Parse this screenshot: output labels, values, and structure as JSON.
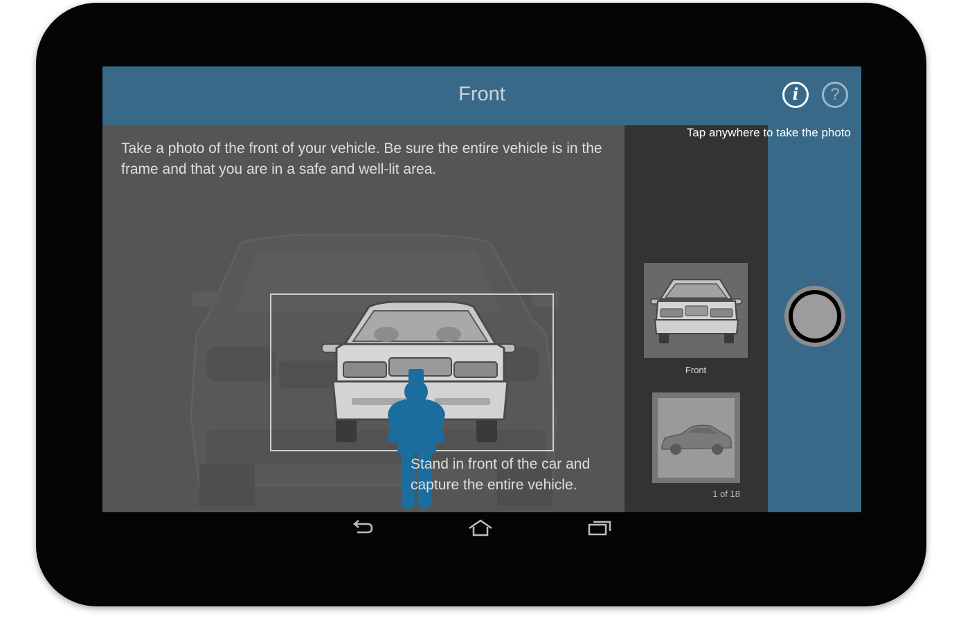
{
  "screen": {
    "title": "Front",
    "tap_hint": "Tap anywhere to take the photo",
    "instructions": "Take a photo of the front of your vehicle. Be sure the entire vehicle is in the frame and that you are in a safe and well-lit area.",
    "stand_hint": "Stand in front of the car and capture the entire vehicle.",
    "info_button_label": "i",
    "help_button_label": "?"
  },
  "thumbnails": {
    "front_label": "Front",
    "count_label": "1 of 18"
  },
  "icons": {
    "info": "info-icon",
    "help": "help-icon",
    "shutter": "shutter-icon",
    "back": "back-icon",
    "home": "home-icon",
    "recents": "recents-icon"
  },
  "colors": {
    "accent": "#396988",
    "figure": "#1a6d9c",
    "screen_background": "#555555",
    "thumbnail_strip": "#333333"
  }
}
